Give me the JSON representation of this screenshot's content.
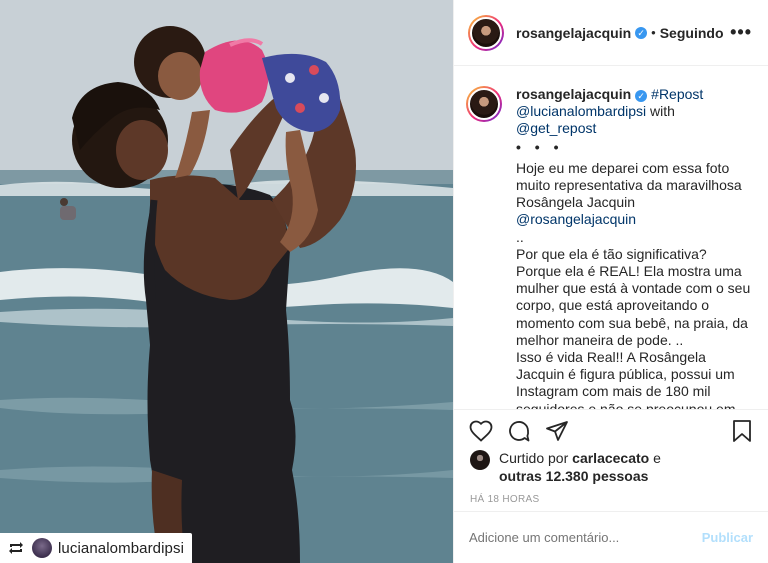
{
  "header": {
    "username": "rosangelajacquin",
    "separator": "•",
    "follow_status": "Seguindo",
    "more_icon": "•••"
  },
  "photo": {
    "repost_user": "lucianalombardipsi",
    "repost_icon": "repost-icon"
  },
  "caption": {
    "username": "rosangelajacquin",
    "repost_tag": "#Repost",
    "mention_1": "@lucianalombardipsi",
    "with_word": " with",
    "mention_2": "@get_repost",
    "dots": "• • •",
    "para_1": "Hoje eu me deparei com essa foto muito representativa da maravilhosa Rosângela Jacquin ",
    "mention_3": "@rosangelajacquin",
    "para_1_end": "..",
    "para_2": "Por que ela é tão significativa? Porque ela é REAL! Ela mostra uma mulher que está à vontade com o seu corpo, que está aproveitando o momento com sua bebê, na praia, da melhor maneira de pode. ..",
    "para_3": "Isso é vida Real!! A Rosângela Jacquin é figura pública, possui um Instagram com mais de 180 mil seguidores e não se preocupou em editar a foto do seu corpo. E é essa atitude que é linda!"
  },
  "likes": {
    "prefix": "Curtido por ",
    "user": "carlacecato",
    "middle": " e",
    "others": "outras 12.380 pessoas"
  },
  "time": "HÁ 18 HORAS",
  "comment": {
    "placeholder": "Adicione um comentário...",
    "publish": "Publicar"
  },
  "colors": {
    "link": "#003569",
    "verified": "#3897f0",
    "publish_disabled": "#b2dffc"
  }
}
